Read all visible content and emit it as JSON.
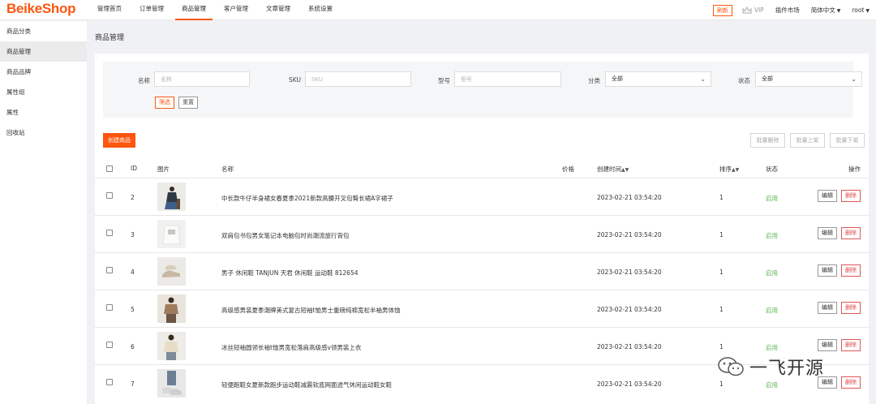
{
  "app": {
    "logo": "BeikeShop"
  },
  "nav": {
    "items": [
      "管理首页",
      "订单管理",
      "商品管理",
      "客户管理",
      "文章管理",
      "系统设置"
    ],
    "active_index": 2
  },
  "top_right": {
    "refresh_label": "刷新",
    "vip_label": "VIP",
    "market_label": "插件市场",
    "language_label": "简体中文",
    "user_label": "root"
  },
  "sidebar": {
    "items": [
      "商品分类",
      "商品管理",
      "商品品牌",
      "属性组",
      "属性",
      "回收站"
    ],
    "active_index": 1
  },
  "page": {
    "title": "商品管理"
  },
  "filter": {
    "name_label": "名称",
    "name_placeholder": "名称",
    "sku_label": "SKU",
    "sku_placeholder": "SKU",
    "model_label": "型号",
    "model_placeholder": "型号",
    "category_label": "分类",
    "category_value": "全部",
    "status_label": "状态",
    "status_value": "全部",
    "filter_button": "筛选",
    "reset_button": "重置"
  },
  "actions": {
    "create_button": "创建商品",
    "batch_delete": "批量删除",
    "batch_on": "批量上架",
    "batch_off": "批量下架"
  },
  "table": {
    "headers": {
      "id": "ID",
      "image": "图片",
      "name": "名称",
      "price": "价格",
      "created": "创建时间",
      "sort": "排序",
      "status": "状态",
      "action": "操作"
    },
    "edit_label": "编辑",
    "delete_label": "删除",
    "rows": [
      {
        "id": "2",
        "name": "中长款牛仔半身裙女春夏季2021新款高腰开叉包臀长裙A字裙子",
        "price": "",
        "created": "2023-02-21 03:54:20",
        "sort": "1",
        "status": "启用"
      },
      {
        "id": "3",
        "name": "双肩包书包男女笔记本电脑包时尚潮流旅行背包",
        "price": "",
        "created": "2023-02-21 03:54:20",
        "sort": "1",
        "status": "启用"
      },
      {
        "id": "4",
        "name": "男子 休闲鞋 TANJUN 天君 休闲鞋 运动鞋 812654",
        "price": "",
        "created": "2023-02-21 03:54:20",
        "sort": "1",
        "status": "启用"
      },
      {
        "id": "5",
        "name": "高级感男装夏季潮牌美式复古短袖t恤男士重磅纯棉宽松半袖男体恤",
        "price": "",
        "created": "2023-02-21 03:54:20",
        "sort": "1",
        "status": "启用"
      },
      {
        "id": "6",
        "name": "冰丝短袖圆领长袖t恤男宽松落肩高级感v领男装上衣",
        "price": "",
        "created": "2023-02-21 03:54:20",
        "sort": "1",
        "status": "启用"
      },
      {
        "id": "7",
        "name": "轻便跑鞋女夏新款跑步运动鞋减震软底网面透气休闲运动鞋女鞋",
        "price": "",
        "created": "2023-02-21 03:54:20",
        "sort": "1",
        "status": "启用"
      }
    ]
  },
  "watermark": {
    "text": "一飞开源"
  },
  "colors": {
    "brand": "#fd560f",
    "status_enabled": "#5fb554",
    "danger": "#e04848"
  }
}
